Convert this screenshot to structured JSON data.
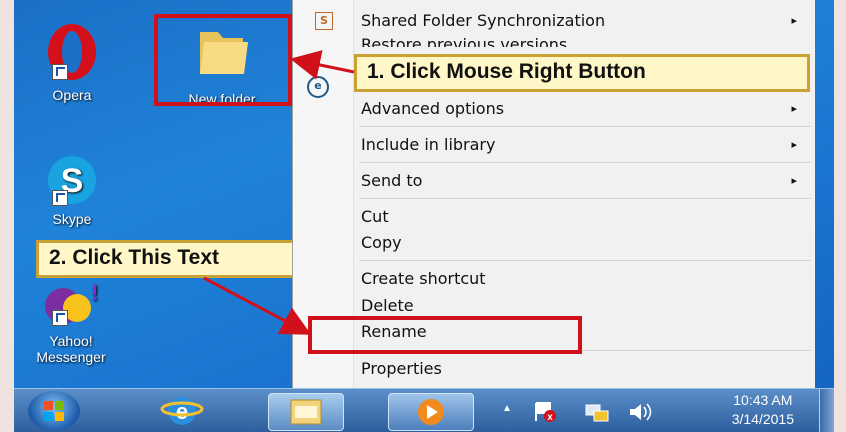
{
  "desktop": {
    "icons": [
      {
        "label": "Opera"
      },
      {
        "label": "New folder"
      },
      {
        "label": "Skype"
      },
      {
        "label_line1": "Yahoo!",
        "label_line2": "Messenger"
      }
    ]
  },
  "context_menu": {
    "items": [
      {
        "label": "Shared Folder Synchronization",
        "has_submenu": true
      },
      {
        "label": "Restore previous versions",
        "has_submenu": false
      },
      {
        "label": "Advanced options",
        "has_submenu": true
      },
      {
        "label": "Include in library",
        "has_submenu": true
      },
      {
        "label": "Send to",
        "has_submenu": true
      },
      {
        "label": "Cut",
        "has_submenu": false
      },
      {
        "label": "Copy",
        "has_submenu": false
      },
      {
        "label": "Create shortcut",
        "has_submenu": false
      },
      {
        "label": "Delete",
        "has_submenu": false
      },
      {
        "label": "Rename",
        "has_submenu": false
      },
      {
        "label": "Properties",
        "has_submenu": false
      }
    ],
    "submenu_arrow": "▸"
  },
  "annotations": {
    "step1": "1. Click Mouse Right Button",
    "step2": "2. Click This Text"
  },
  "taskbar": {
    "clock_time": "10:43 AM",
    "clock_date": "3/14/2015",
    "tray_up_arrow": "▲",
    "icons": [
      "start-orb-icon",
      "internet-explorer-icon",
      "windows-explorer-icon",
      "media-player-icon"
    ]
  },
  "colors": {
    "highlight_red": "#d0101a",
    "callout_bg": "#fff7c8",
    "desktop_blue": "#1c6fc7"
  }
}
